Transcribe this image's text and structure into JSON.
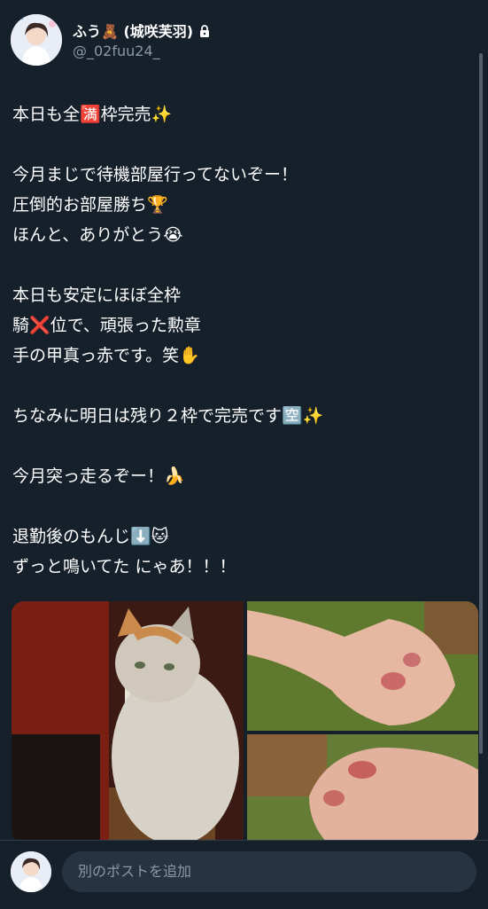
{
  "author": {
    "display_name": "ふう🧸 (城咲芙羽)",
    "handle": "@_02fuu24_",
    "protected_icon": "lock-icon"
  },
  "post": {
    "text": "本日も全🈵枠完売✨\n\n今月まじで待機部屋行ってないぞー！\n圧倒的お部屋勝ち🏆\nほんと、ありがとう😭\n\n本日も安定にほぼ全枠\n騎❌位で、頑張った勲章\n手の甲真っ赤です。笑✋\n\nちなみに明日は残り２枠で完売です🈳✨\n\n今月突っ走るぞー！🍌\n\n退勤後のもんじ⬇️🐱\nずっと鳴いてた にゃあ！！！"
  },
  "media": [
    {
      "name": "cat-photo"
    },
    {
      "name": "red-hand-photo-1"
    },
    {
      "name": "red-hand-photo-2"
    }
  ],
  "reply": {
    "placeholder": "別のポストを追加"
  },
  "colors": {
    "background": "#15202b",
    "secondary_text": "#8b98a5",
    "input_bg": "#273340"
  }
}
